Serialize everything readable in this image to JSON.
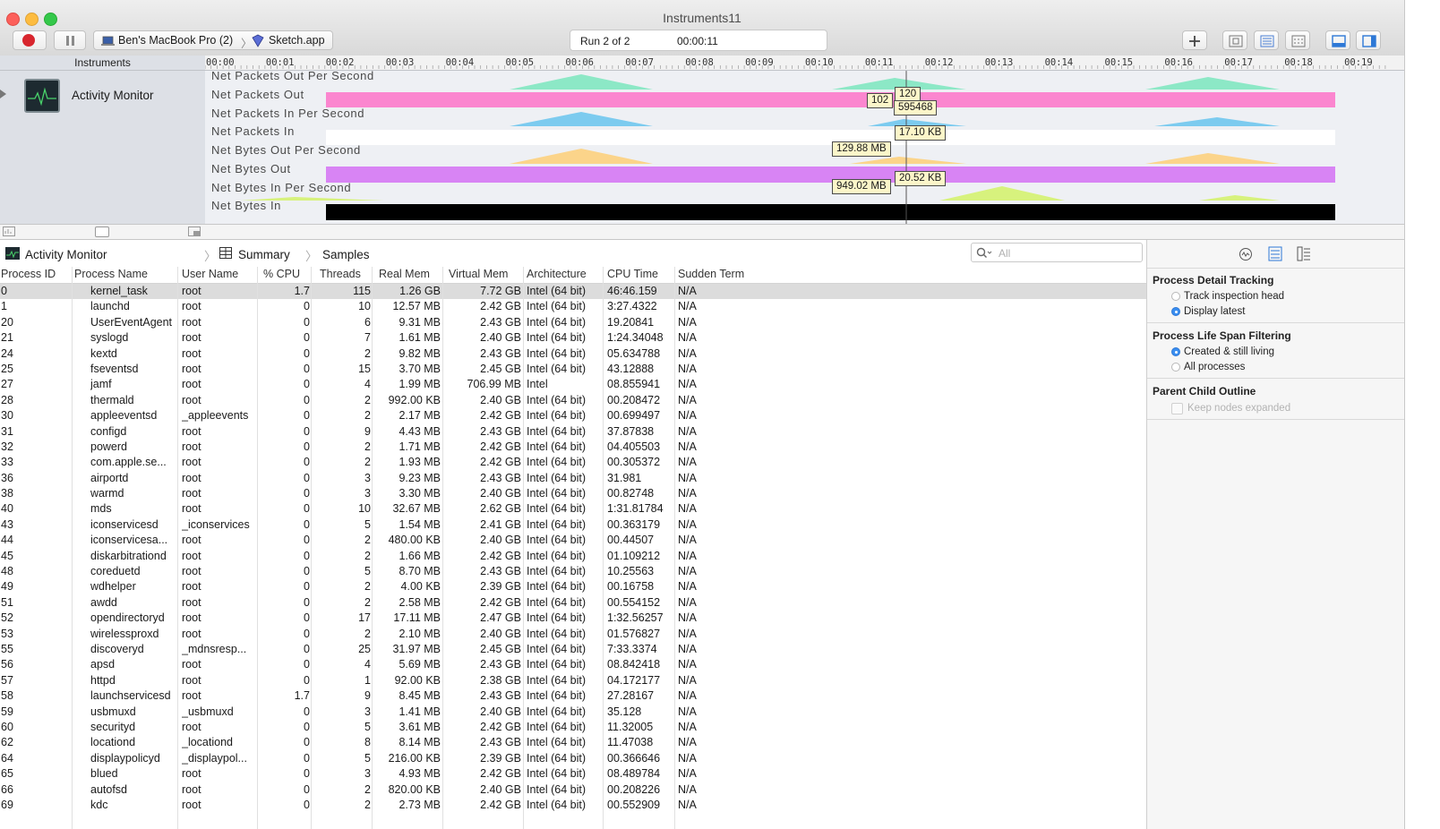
{
  "window": {
    "title": "Instruments11",
    "colors": {
      "close": "#fc605b",
      "minimize": "#fdbc40",
      "zoom": "#34c84a",
      "record": "#d8262e"
    }
  },
  "toolbar": {
    "path": {
      "device": "Ben's MacBook Pro (2)",
      "target": "Sketch.app"
    },
    "run_label": "Run 2 of 2",
    "run_time": "00:00:11"
  },
  "instruments": {
    "header": "Instruments",
    "name": "Activity Monitor",
    "ruler_ticks": [
      "00:00",
      "00:01",
      "00:02",
      "00:03",
      "00:04",
      "00:05",
      "00:06",
      "00:07",
      "00:08",
      "00:09",
      "00:10",
      "00:11",
      "00:12",
      "00:13",
      "00:14",
      "00:15",
      "00:16",
      "00:17",
      "00:18",
      "00:19"
    ],
    "tracks": [
      "Net Packets Out Per Second",
      "Net Packets Out",
      "Net Packets In Per Second",
      "Net Packets In",
      "Net Bytes Out Per Second",
      "Net Bytes Out",
      "Net Bytes In Per Second",
      "Net Bytes In"
    ],
    "callouts": [
      "120",
      "102",
      "595468",
      "17.10 KB",
      "129.88 MB",
      "20.52 KB",
      "949.02 MB"
    ]
  },
  "jumpbar": {
    "instrument": "Activity Monitor",
    "view": "Summary",
    "section": "Samples"
  },
  "search": {
    "placeholder": "All"
  },
  "table": {
    "columns": [
      "Process ID",
      "Process Name",
      "User Name",
      "% CPU",
      "Threads",
      "Real Mem",
      "Virtual Mem",
      "Architecture",
      "CPU Time",
      "Sudden Term"
    ],
    "rows": [
      [
        "0",
        "kernel_task",
        "root",
        "1.7",
        "115",
        "1.26 GB",
        "7.72 GB",
        "Intel (64 bit)",
        "46:46.159",
        "N/A"
      ],
      [
        "1",
        "launchd",
        "root",
        "0",
        "10",
        "12.57 MB",
        "2.42 GB",
        "Intel (64 bit)",
        "3:27.4322",
        "N/A"
      ],
      [
        "20",
        "UserEventAgent",
        "root",
        "0",
        "6",
        "9.31 MB",
        "2.43 GB",
        "Intel (64 bit)",
        "19.20841",
        "N/A"
      ],
      [
        "21",
        "syslogd",
        "root",
        "0",
        "7",
        "1.61 MB",
        "2.40 GB",
        "Intel (64 bit)",
        "1:24.34048",
        "N/A"
      ],
      [
        "24",
        "kextd",
        "root",
        "0",
        "2",
        "9.82 MB",
        "2.43 GB",
        "Intel (64 bit)",
        "05.634788",
        "N/A"
      ],
      [
        "25",
        "fseventsd",
        "root",
        "0",
        "15",
        "3.70 MB",
        "2.45 GB",
        "Intel (64 bit)",
        "43.12888",
        "N/A"
      ],
      [
        "27",
        "jamf",
        "root",
        "0",
        "4",
        "1.99 MB",
        "706.99 MB",
        "Intel",
        "08.855941",
        "N/A"
      ],
      [
        "28",
        "thermald",
        "root",
        "0",
        "2",
        "992.00 KB",
        "2.40 GB",
        "Intel (64 bit)",
        "00.208472",
        "N/A"
      ],
      [
        "30",
        "appleeventsd",
        "_appleevents",
        "0",
        "2",
        "2.17 MB",
        "2.42 GB",
        "Intel (64 bit)",
        "00.699497",
        "N/A"
      ],
      [
        "31",
        "configd",
        "root",
        "0",
        "9",
        "4.43 MB",
        "2.43 GB",
        "Intel (64 bit)",
        "37.87838",
        "N/A"
      ],
      [
        "32",
        "powerd",
        "root",
        "0",
        "2",
        "1.71 MB",
        "2.42 GB",
        "Intel (64 bit)",
        "04.405503",
        "N/A"
      ],
      [
        "33",
        "com.apple.se...",
        "root",
        "0",
        "2",
        "1.93 MB",
        "2.42 GB",
        "Intel (64 bit)",
        "00.305372",
        "N/A"
      ],
      [
        "36",
        "airportd",
        "root",
        "0",
        "3",
        "9.23 MB",
        "2.43 GB",
        "Intel (64 bit)",
        "31.981",
        "N/A"
      ],
      [
        "38",
        "warmd",
        "root",
        "0",
        "3",
        "3.30 MB",
        "2.40 GB",
        "Intel (64 bit)",
        "00.82748",
        "N/A"
      ],
      [
        "40",
        "mds",
        "root",
        "0",
        "10",
        "32.67 MB",
        "2.62 GB",
        "Intel (64 bit)",
        "1:31.81784",
        "N/A"
      ],
      [
        "43",
        "iconservicesd",
        "_iconservices",
        "0",
        "5",
        "1.54 MB",
        "2.41 GB",
        "Intel (64 bit)",
        "00.363179",
        "N/A"
      ],
      [
        "44",
        "iconservicesa...",
        "root",
        "0",
        "2",
        "480.00 KB",
        "2.40 GB",
        "Intel (64 bit)",
        "00.44507",
        "N/A"
      ],
      [
        "45",
        "diskarbitrationd",
        "root",
        "0",
        "2",
        "1.66 MB",
        "2.42 GB",
        "Intel (64 bit)",
        "01.109212",
        "N/A"
      ],
      [
        "48",
        "coreduetd",
        "root",
        "0",
        "5",
        "8.70 MB",
        "2.43 GB",
        "Intel (64 bit)",
        "10.25563",
        "N/A"
      ],
      [
        "49",
        "wdhelper",
        "root",
        "0",
        "2",
        "4.00 KB",
        "2.39 GB",
        "Intel (64 bit)",
        "00.16758",
        "N/A"
      ],
      [
        "51",
        "awdd",
        "root",
        "0",
        "2",
        "2.58 MB",
        "2.42 GB",
        "Intel (64 bit)",
        "00.554152",
        "N/A"
      ],
      [
        "52",
        "opendirectoryd",
        "root",
        "0",
        "17",
        "17.11 MB",
        "2.47 GB",
        "Intel (64 bit)",
        "1:32.56257",
        "N/A"
      ],
      [
        "53",
        "wirelessproxd",
        "root",
        "0",
        "2",
        "2.10 MB",
        "2.40 GB",
        "Intel (64 bit)",
        "01.576827",
        "N/A"
      ],
      [
        "55",
        "discoveryd",
        "_mdnsresp...",
        "0",
        "25",
        "31.97 MB",
        "2.45 GB",
        "Intel (64 bit)",
        "7:33.3374",
        "N/A"
      ],
      [
        "56",
        "apsd",
        "root",
        "0",
        "4",
        "5.69 MB",
        "2.43 GB",
        "Intel (64 bit)",
        "08.842418",
        "N/A"
      ],
      [
        "57",
        "httpd",
        "root",
        "0",
        "1",
        "92.00 KB",
        "2.38 GB",
        "Intel (64 bit)",
        "04.172177",
        "N/A"
      ],
      [
        "58",
        "launchservicesd",
        "root",
        "1.7",
        "9",
        "8.45 MB",
        "2.43 GB",
        "Intel (64 bit)",
        "27.28167",
        "N/A"
      ],
      [
        "59",
        "usbmuxd",
        "_usbmuxd",
        "0",
        "3",
        "1.41 MB",
        "2.40 GB",
        "Intel (64 bit)",
        "35.128",
        "N/A"
      ],
      [
        "60",
        "securityd",
        "root",
        "0",
        "5",
        "3.61 MB",
        "2.42 GB",
        "Intel (64 bit)",
        "11.32005",
        "N/A"
      ],
      [
        "62",
        "locationd",
        "_locationd",
        "0",
        "8",
        "8.14 MB",
        "2.43 GB",
        "Intel (64 bit)",
        "11.47038",
        "N/A"
      ],
      [
        "64",
        "displaypolicyd",
        "_displaypol...",
        "0",
        "5",
        "216.00 KB",
        "2.39 GB",
        "Intel (64 bit)",
        "00.366646",
        "N/A"
      ],
      [
        "65",
        "blued",
        "root",
        "0",
        "3",
        "4.93 MB",
        "2.42 GB",
        "Intel (64 bit)",
        "08.489784",
        "N/A"
      ],
      [
        "66",
        "autofsd",
        "root",
        "0",
        "2",
        "820.00 KB",
        "2.40 GB",
        "Intel (64 bit)",
        "00.208226",
        "N/A"
      ],
      [
        "69",
        "kdc",
        "root",
        "0",
        "2",
        "2.73 MB",
        "2.42 GB",
        "Intel (64 bit)",
        "00.552909",
        "N/A"
      ]
    ]
  },
  "inspector": {
    "detail_tracking": {
      "title": "Process Detail Tracking",
      "options": [
        "Track inspection head",
        "Display latest"
      ],
      "selected": "Display latest"
    },
    "life_span": {
      "title": "Process Life Span Filtering",
      "options": [
        "Created & still living",
        "All processes"
      ],
      "selected": "Created & still living"
    },
    "child_outline": {
      "title": "Parent Child Outline",
      "option": "Keep nodes expanded"
    }
  }
}
